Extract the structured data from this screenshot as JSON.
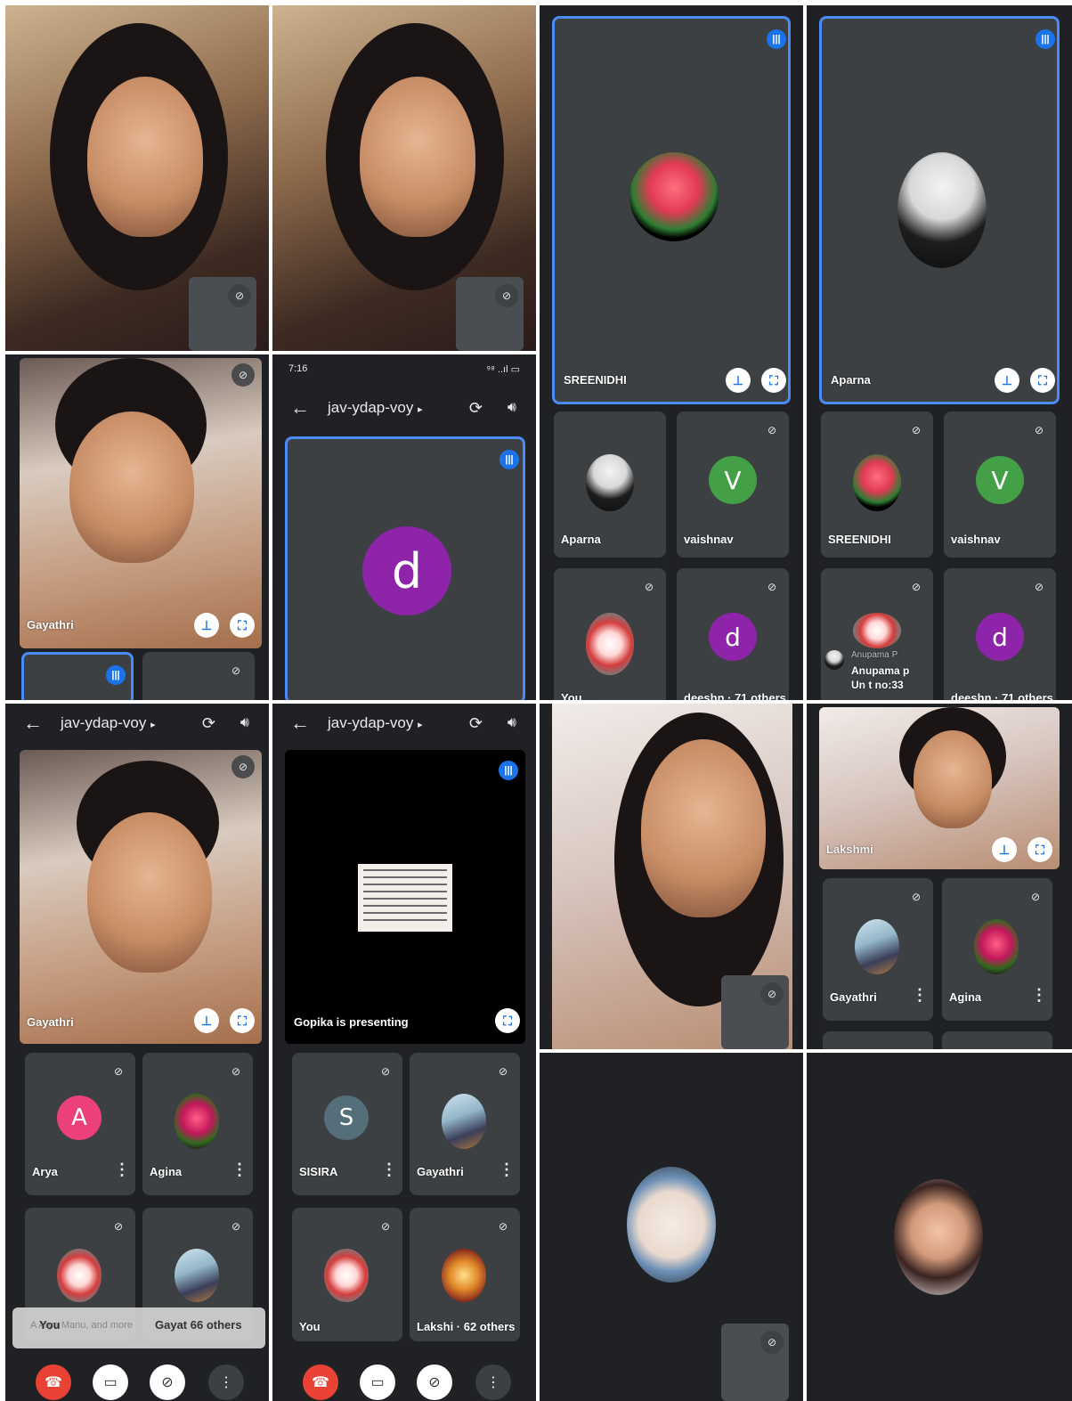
{
  "meeting": {
    "code": "jav-ydap-voy",
    "code_caret": "▸",
    "status_time": "7:16",
    "status_right": "⁹⁸ ..ıl ▭"
  },
  "colors": {
    "blue_accent": "#4b8bf5",
    "tile_bg": "#3c4043",
    "bg": "#202124",
    "avatar_d": "#8e24aa",
    "avatar_v": "#43a047",
    "avatar_a": "#ec407a",
    "avatar_s": "#546e7a",
    "end_call": "#ea4335"
  },
  "panel_row1": {
    "sreenidhi_label": "SREENIDHI",
    "aparna_label": "Aparna",
    "aparna_small": "Aparna",
    "vaishnav_small": "vaishnav",
    "vaishnav_initial": "V",
    "you_label": "You",
    "deeshn_others": "deeshn · 71 others",
    "d_initial": "d",
    "sreenidhi_small": "SREENIDHI",
    "anupama_line1": "Anupama P",
    "anupama_line2": "Anupama p",
    "anupama_line3": "Un t no:33"
  },
  "panel_row2": {
    "gayathri_label": "Gayathri",
    "d_initial": "d"
  },
  "panel_row3": {
    "gayathri_label": "Gayathri",
    "arya": "Arya",
    "arya_initial": "A",
    "agina": "Agina",
    "you": "You",
    "gayat_others": "Gayat 66 others",
    "toast_text": "A Arya Manu, and more",
    "gopika_presenting": "Gopika is presenting",
    "sisira": "SISIRA",
    "sisira_initial": "S",
    "gayathri_small": "Gayathri",
    "you2": "You",
    "lakshi_others": "Lakshi · 62 others"
  },
  "panel_row3_right": {
    "lakshmi_label": "Lakshmi",
    "gayathri_small": "Gayathri",
    "agina_small": "Agina"
  },
  "icons": {
    "mic_off": "mic-off-icon",
    "pin": "pin-icon",
    "expand": "fullscreen-icon",
    "speaking": "audio-level-icon",
    "back": "arrow-back-icon",
    "switch_camera": "switch-camera-icon",
    "speaker": "speaker-icon",
    "more": "more-vert-icon",
    "end_call": "call-end-icon",
    "cam_off": "videocam-off-icon"
  }
}
